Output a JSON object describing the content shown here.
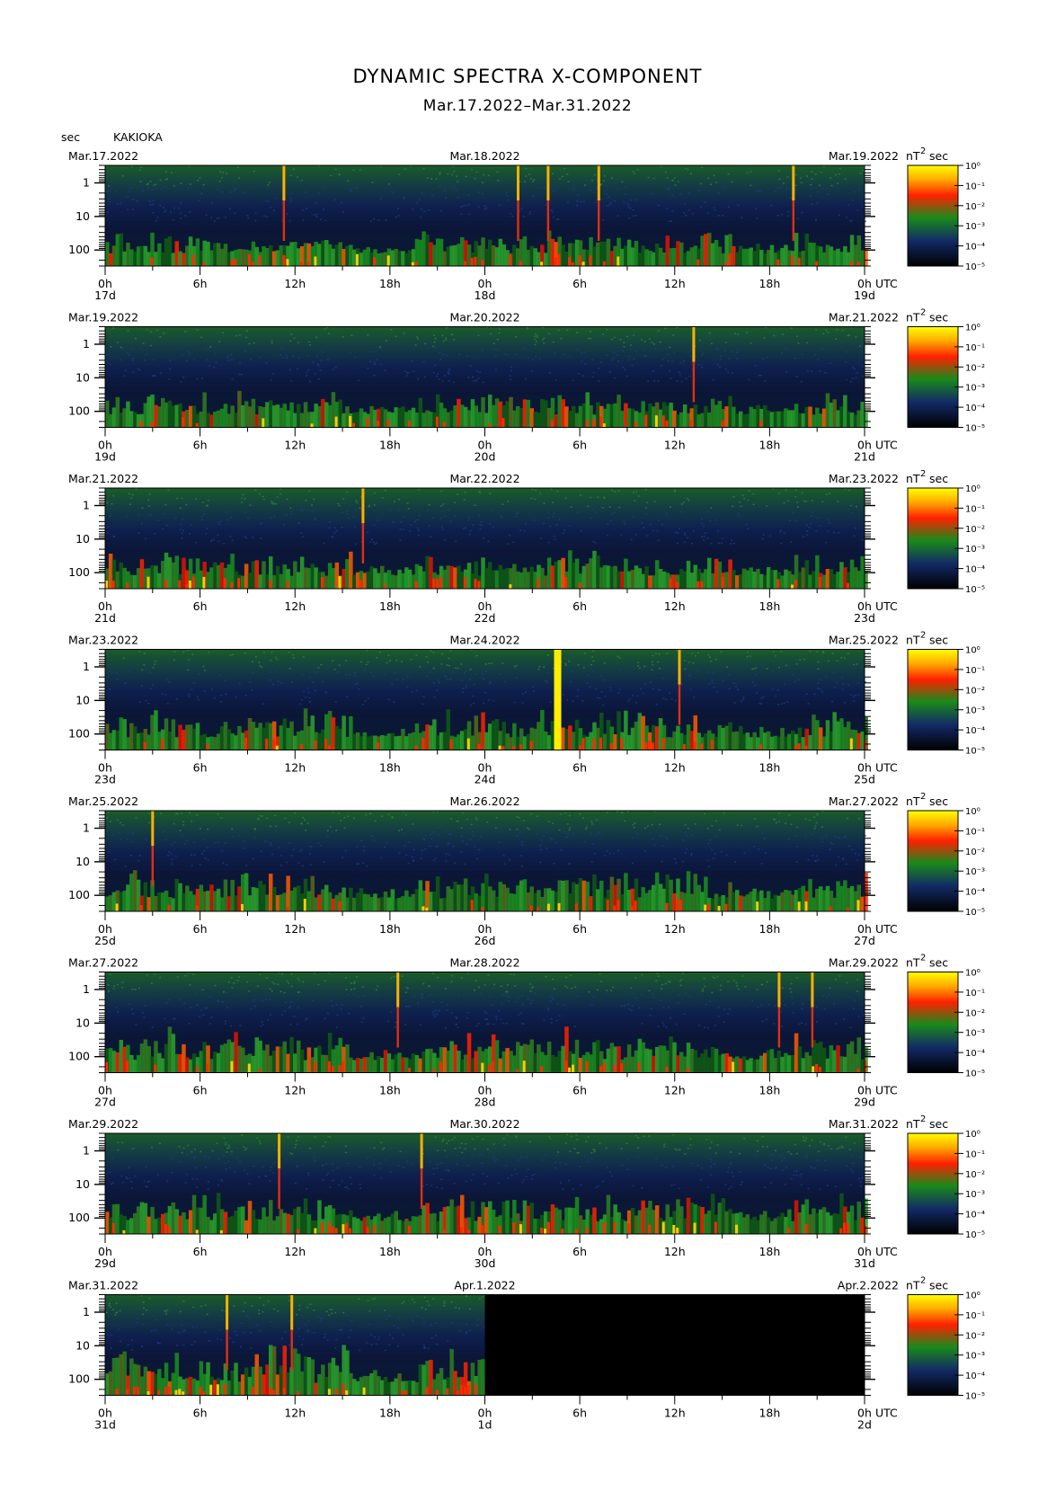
{
  "figure": {
    "title": "DYNAMIC SPECTRA X-COMPONENT",
    "subtitle": "Mar.17.2022–Mar.31.2022",
    "y_unit_label": "sec",
    "station": "KAKIOKA",
    "unit_label": "nT",
    "unit_exponent": "2",
    "unit_suffix": "sec",
    "x_unit": "UTC"
  },
  "chart_data": {
    "type": "heatmap",
    "title": "DYNAMIC SPECTRA X-COMPONENT",
    "subtitle": "Mar.17.2022–Mar.31.2022",
    "ylabel": "sec",
    "yscale": "log",
    "ylim": [
      0.3,
      300
    ],
    "yticks": [
      "1",
      "10",
      "100"
    ],
    "xticks": [
      "0h",
      "6h",
      "12h",
      "18h",
      "0h",
      "6h",
      "12h",
      "18h",
      "0h"
    ],
    "x_unit": "UTC",
    "colorbar": {
      "label": "nT²sec",
      "scale": "log",
      "ticks": [
        "10⁰",
        "10⁻¹",
        "10⁻²",
        "10⁻³",
        "10⁻⁴",
        "10⁻⁵"
      ],
      "colors": [
        "#ffff00",
        "#ffaa00",
        "#ff2000",
        "#1a8a1a",
        "#122a66",
        "#000000"
      ]
    },
    "panels": [
      {
        "start_label": "Mar.17.2022",
        "mid_label": "Mar.18.2022",
        "end_label": "Mar.19.2022",
        "day_labels": [
          "17d",
          "18d",
          "19d"
        ],
        "spikes": [
          11.3,
          26.1,
          28.0,
          31.2,
          43.5
        ],
        "strong_spike": null,
        "data_end": 48,
        "base_level": 0.5,
        "quiet": [
          [
            15.5,
            19.5
          ],
          [
            39.5,
            43.5
          ]
        ]
      },
      {
        "start_label": "Mar.19.2022",
        "mid_label": "Mar.20.2022",
        "end_label": "Mar.21.2022",
        "day_labels": [
          "19d",
          "20d",
          "21d"
        ],
        "spikes": [
          37.2
        ],
        "strong_spike": null,
        "data_end": 48,
        "base_level": 0.5,
        "quiet": [
          [
            15.5,
            19.5
          ],
          [
            39.5,
            43.5
          ]
        ]
      },
      {
        "start_label": "Mar.21.2022",
        "mid_label": "Mar.22.2022",
        "end_label": "Mar.23.2022",
        "day_labels": [
          "21d",
          "22d",
          "23d"
        ],
        "spikes": [
          16.3
        ],
        "strong_spike": null,
        "data_end": 48,
        "base_level": 0.55,
        "quiet": [
          [
            15.5,
            19.5
          ],
          [
            39.5,
            43.5
          ]
        ]
      },
      {
        "start_label": "Mar.23.2022",
        "mid_label": "Mar.24.2022",
        "end_label": "Mar.25.2022",
        "day_labels": [
          "23d",
          "24d",
          "25d"
        ],
        "spikes": [
          36.3
        ],
        "strong_spike": 28.6,
        "data_end": 48,
        "base_level": 0.6,
        "quiet": [
          [
            15.5,
            19.5
          ],
          [
            39.5,
            43.5
          ]
        ]
      },
      {
        "start_label": "Mar.25.2022",
        "mid_label": "Mar.26.2022",
        "end_label": "Mar.27.2022",
        "day_labels": [
          "25d",
          "26d",
          "27d"
        ],
        "spikes": [
          3.0
        ],
        "strong_spike": null,
        "data_end": 48,
        "base_level": 0.6,
        "quiet": [
          [
            15.5,
            19.5
          ],
          [
            39.5,
            43.5
          ]
        ]
      },
      {
        "start_label": "Mar.27.2022",
        "mid_label": "Mar.28.2022",
        "end_label": "Mar.29.2022",
        "day_labels": [
          "27d",
          "28d",
          "29d"
        ],
        "spikes": [
          18.5,
          42.6,
          44.7
        ],
        "strong_spike": null,
        "data_end": 48,
        "base_level": 0.7,
        "quiet": [
          [
            15.5,
            19.5
          ],
          [
            39.5,
            43.5
          ]
        ]
      },
      {
        "start_label": "Mar.29.2022",
        "mid_label": "Mar.30.2022",
        "end_label": "Mar.31.2022",
        "day_labels": [
          "29d",
          "30d",
          "31d"
        ],
        "spikes": [
          11.0,
          20.0
        ],
        "strong_spike": null,
        "data_end": 48,
        "base_level": 0.6,
        "quiet": [
          [
            15.5,
            19.5
          ],
          [
            39.5,
            43.5
          ]
        ]
      },
      {
        "start_label": "Mar.31.2022",
        "mid_label": "Apr.1.2022",
        "end_label": "Apr.2.2022",
        "day_labels": [
          "31d",
          "1d",
          "2d"
        ],
        "spikes": [
          7.7,
          11.8
        ],
        "strong_spike": null,
        "data_end": 24,
        "base_level": 0.9,
        "quiet": [
          [
            15.5,
            19.5
          ]
        ]
      }
    ]
  }
}
